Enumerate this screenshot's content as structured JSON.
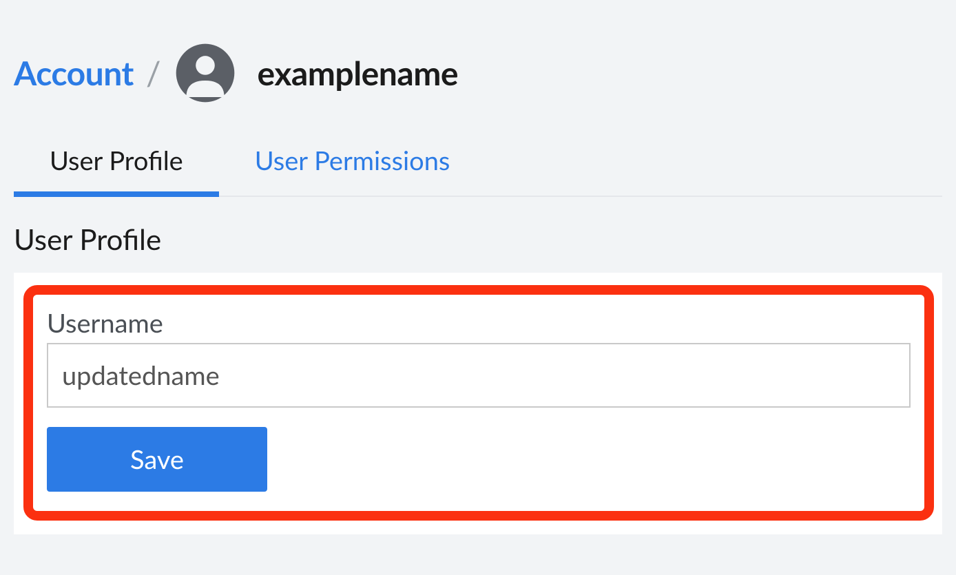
{
  "breadcrumb": {
    "root_label": "Account",
    "separator": "/",
    "current_label": "examplename"
  },
  "tabs": {
    "profile_label": "User Profile",
    "permissions_label": "User Permissions"
  },
  "section": {
    "title": "User Profile"
  },
  "form": {
    "username_label": "Username",
    "username_value": "updatedname",
    "save_label": "Save"
  }
}
